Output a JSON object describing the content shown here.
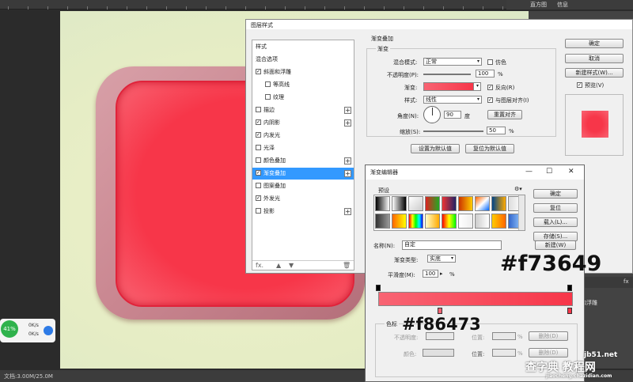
{
  "topbar": {
    "tab1": "直方图",
    "tab2": "信息"
  },
  "status": {
    "doc": "文档:3.00M/25.0M"
  },
  "net_widget": {
    "percent": "41%",
    "up": "0K/s",
    "down": "0K/s"
  },
  "right_panel": {
    "fx1": "fx",
    "fx2": "fx",
    "item": "和浮雕"
  },
  "layer_dialog": {
    "title": "图层样式",
    "styles": [
      {
        "label": "样式",
        "checkbox": false,
        "checked": false,
        "plus": false,
        "indent": false,
        "selected": false
      },
      {
        "label": "混合选项",
        "checkbox": false,
        "checked": false,
        "plus": false,
        "indent": false,
        "selected": false
      },
      {
        "label": "斜面和浮雕",
        "checkbox": true,
        "checked": true,
        "plus": false,
        "indent": false,
        "selected": false
      },
      {
        "label": "等高线",
        "checkbox": true,
        "checked": false,
        "plus": false,
        "indent": true,
        "selected": false
      },
      {
        "label": "纹理",
        "checkbox": true,
        "checked": false,
        "plus": false,
        "indent": true,
        "selected": false
      },
      {
        "label": "描边",
        "checkbox": true,
        "checked": false,
        "plus": true,
        "indent": false,
        "selected": false
      },
      {
        "label": "内阴影",
        "checkbox": true,
        "checked": true,
        "plus": true,
        "indent": false,
        "selected": false
      },
      {
        "label": "内发光",
        "checkbox": true,
        "checked": true,
        "plus": false,
        "indent": false,
        "selected": false
      },
      {
        "label": "光泽",
        "checkbox": true,
        "checked": false,
        "plus": false,
        "indent": false,
        "selected": false
      },
      {
        "label": "颜色叠加",
        "checkbox": true,
        "checked": false,
        "plus": true,
        "indent": false,
        "selected": false
      },
      {
        "label": "渐变叠加",
        "checkbox": true,
        "checked": true,
        "plus": true,
        "indent": false,
        "selected": true
      },
      {
        "label": "图案叠加",
        "checkbox": true,
        "checked": false,
        "plus": false,
        "indent": false,
        "selected": false
      },
      {
        "label": "外发光",
        "checkbox": true,
        "checked": true,
        "plus": false,
        "indent": false,
        "selected": false
      },
      {
        "label": "投影",
        "checkbox": true,
        "checked": false,
        "plus": true,
        "indent": false,
        "selected": false
      }
    ],
    "footer": {
      "fx": "fx."
    },
    "section_title": "渐变叠加",
    "subsection": "渐变",
    "blend_mode_label": "混合模式:",
    "blend_mode": "正常",
    "dither_label": "仿色",
    "opacity_label": "不透明度(P):",
    "opacity": "100",
    "percent": "%",
    "gradient_label": "渐变:",
    "reverse_label": "反向(R)",
    "style_label": "样式:",
    "style_value": "线性",
    "align_label": "与图层对齐(I)",
    "angle_label": "角度(N):",
    "angle": "90",
    "degree": "度",
    "reset_align": "重置对齐",
    "scale_label": "缩放(S):",
    "scale": "50",
    "set_default": "设置为默认值",
    "reset_default": "复位为默认值",
    "ok": "确定",
    "cancel": "取消",
    "new_style": "新建样式(W)...",
    "preview": "预览(V)"
  },
  "grad_editor": {
    "title": "渐变编辑器",
    "presets_label": "预设",
    "name_label": "名称(N):",
    "name_value": "自定",
    "ok": "确定",
    "reset": "复位",
    "load": "载入(L)...",
    "save": "存储(S)...",
    "new": "新建(W)",
    "type_label": "渐变类型:",
    "type_value": "实底",
    "smooth_label": "平滑度(M):",
    "smooth_value": "100",
    "percent": "%",
    "color_stop": "色标",
    "opacity_label": "不透明度:",
    "position1": "位置:",
    "delete1": "删除(D)",
    "color_label": "颜色:",
    "position2": "位置:",
    "delete2": "删除(D)"
  },
  "annotations": {
    "hex_end": "#f73649",
    "hex_start": "#f86473"
  },
  "watermark": {
    "line1": "jb51.net",
    "line2": "查字典 教程网",
    "line3": "jiaocheng.chazidian.com"
  },
  "colors": {
    "start": "#f86473",
    "end": "#f73649",
    "selected": "#3399ff"
  }
}
